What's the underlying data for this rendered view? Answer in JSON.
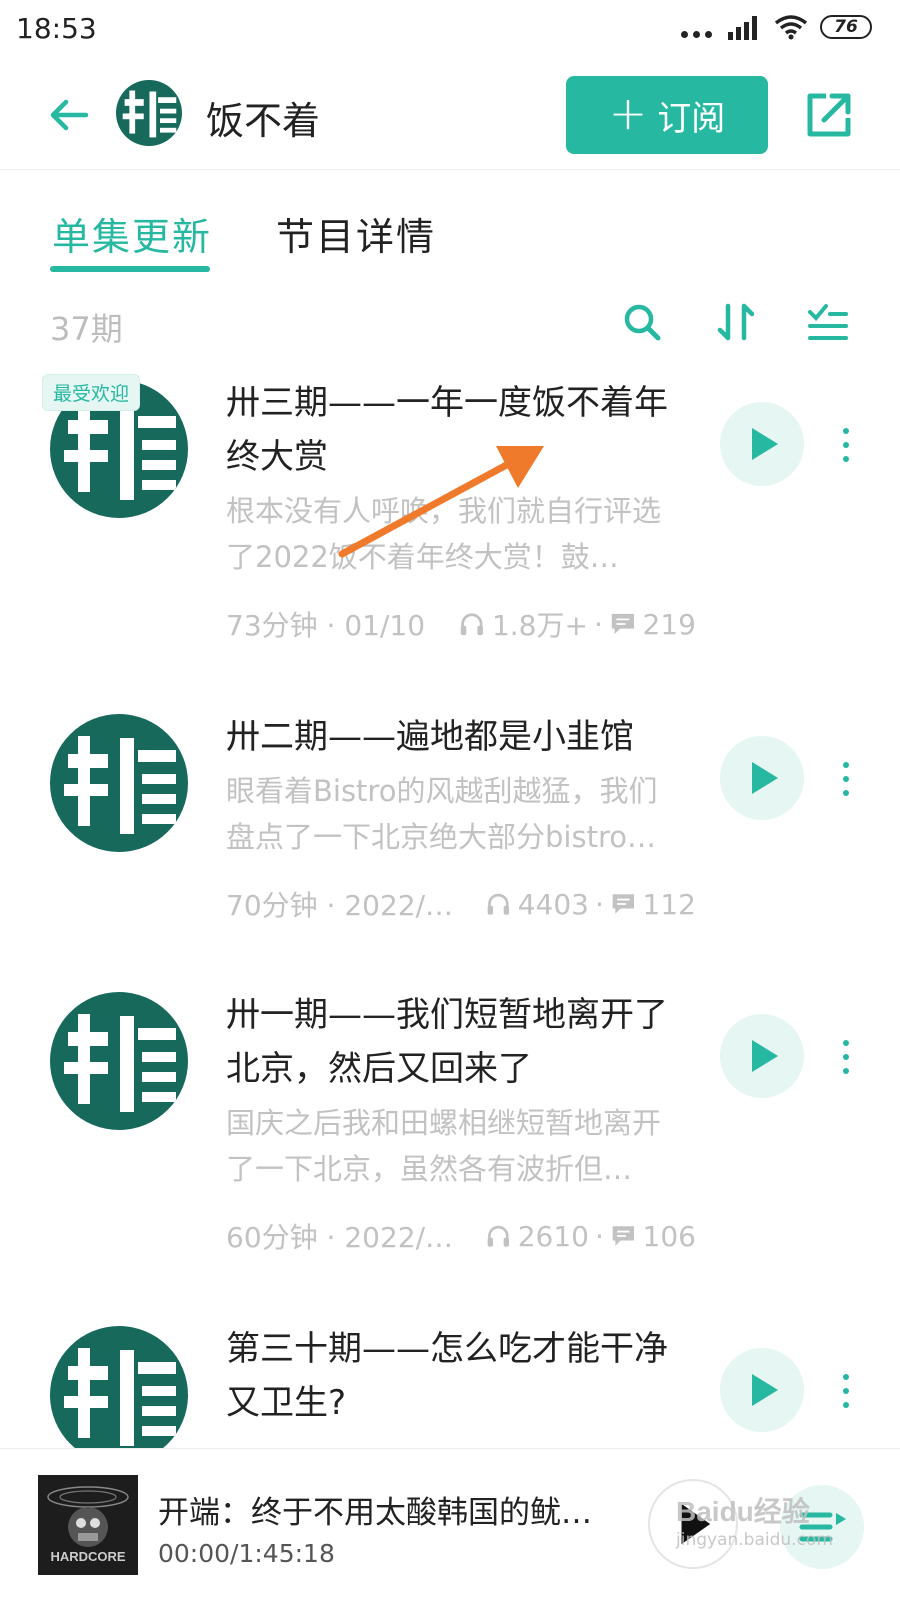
{
  "status_bar": {
    "time": "18:53",
    "battery": "76"
  },
  "header": {
    "title": "饭不着",
    "subscribe_label": "订阅"
  },
  "tabs": [
    {
      "label": "单集更新",
      "active": true
    },
    {
      "label": "节目详情",
      "active": false
    }
  ],
  "toolbar": {
    "count": "37期"
  },
  "episodes": [
    {
      "badge": "最受欢迎",
      "title": "卅三期——一年一度饭不着年终大赏",
      "description": "根本没有人呼唤，我们就自行评选了2022饭不着年终大赏！鼓…",
      "duration_date": "73分钟 · 01/10",
      "plays": "1.8万+",
      "comments": "219"
    },
    {
      "badge": "",
      "title": "卅二期——遍地都是小韭馆",
      "description": "眼看着Bistro的风越刮越猛，我们盘点了一下北京绝大部分bistro…",
      "duration_date": "70分钟 · 2022/…",
      "plays": "4403",
      "comments": "112"
    },
    {
      "badge": "",
      "title": "卅一期——我们短暂地离开了北京，然后又回来了",
      "description": "国庆之后我和田螺相继短暂地离开了一下北京，虽然各有波折但…",
      "duration_date": "60分钟 · 2022/…",
      "plays": "2610",
      "comments": "106"
    },
    {
      "badge": "",
      "title": "第三十期——怎么吃才能干净又卫生?",
      "description": "",
      "duration_date": "",
      "plays": "",
      "comments": ""
    }
  ],
  "player": {
    "title": "开端：终于不用太酸韩国的鱿…",
    "time": "00:00/1:45:18",
    "cover_text": "HARDCORE"
  },
  "watermark": {
    "brand": "Baidu经验",
    "url": "jingyan.baidu.com"
  },
  "colors": {
    "accent": "#26b8a1",
    "cover": "#17695c",
    "annotation_arrow": "#f07a2c"
  },
  "icons": [
    "back-arrow-icon",
    "share-icon",
    "search-icon",
    "sort-icon",
    "filter-list-icon",
    "headphone-icon",
    "comment-icon",
    "play-icon",
    "more-vertical-icon",
    "playlist-icon"
  ]
}
